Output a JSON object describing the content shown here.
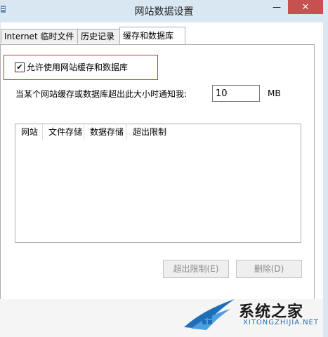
{
  "window": {
    "title": "网站数据设置",
    "close_glyph": "✕",
    "minimize_glyph": "—"
  },
  "tabs": [
    {
      "label": "Internet 临时文件"
    },
    {
      "label": "历史记录"
    },
    {
      "label": "缓存和数据库"
    }
  ],
  "settings": {
    "allow_cache_checked": true,
    "allow_cache_label": "允许使用网站缓存和数据库",
    "notify_label": "当某个网站缓存或数据库超出此大小时通知我:",
    "size_value": "10",
    "size_unit": "MB"
  },
  "list": {
    "columns": [
      "网站",
      "文件存储",
      "数据存储",
      "超出限制"
    ]
  },
  "buttons": {
    "limit_label": "超出限制(E)",
    "delete_label": "删除(D)"
  },
  "watermark": {
    "brand": "系统之家",
    "domain": "XITONGZHIJIA.NET"
  },
  "colors": {
    "titlebar": "#d9e7f3",
    "close": "#c75050",
    "highlight": "#c0392b",
    "logo_blue": "#1f6fb8"
  },
  "icons": {
    "checkbox": "✔"
  }
}
